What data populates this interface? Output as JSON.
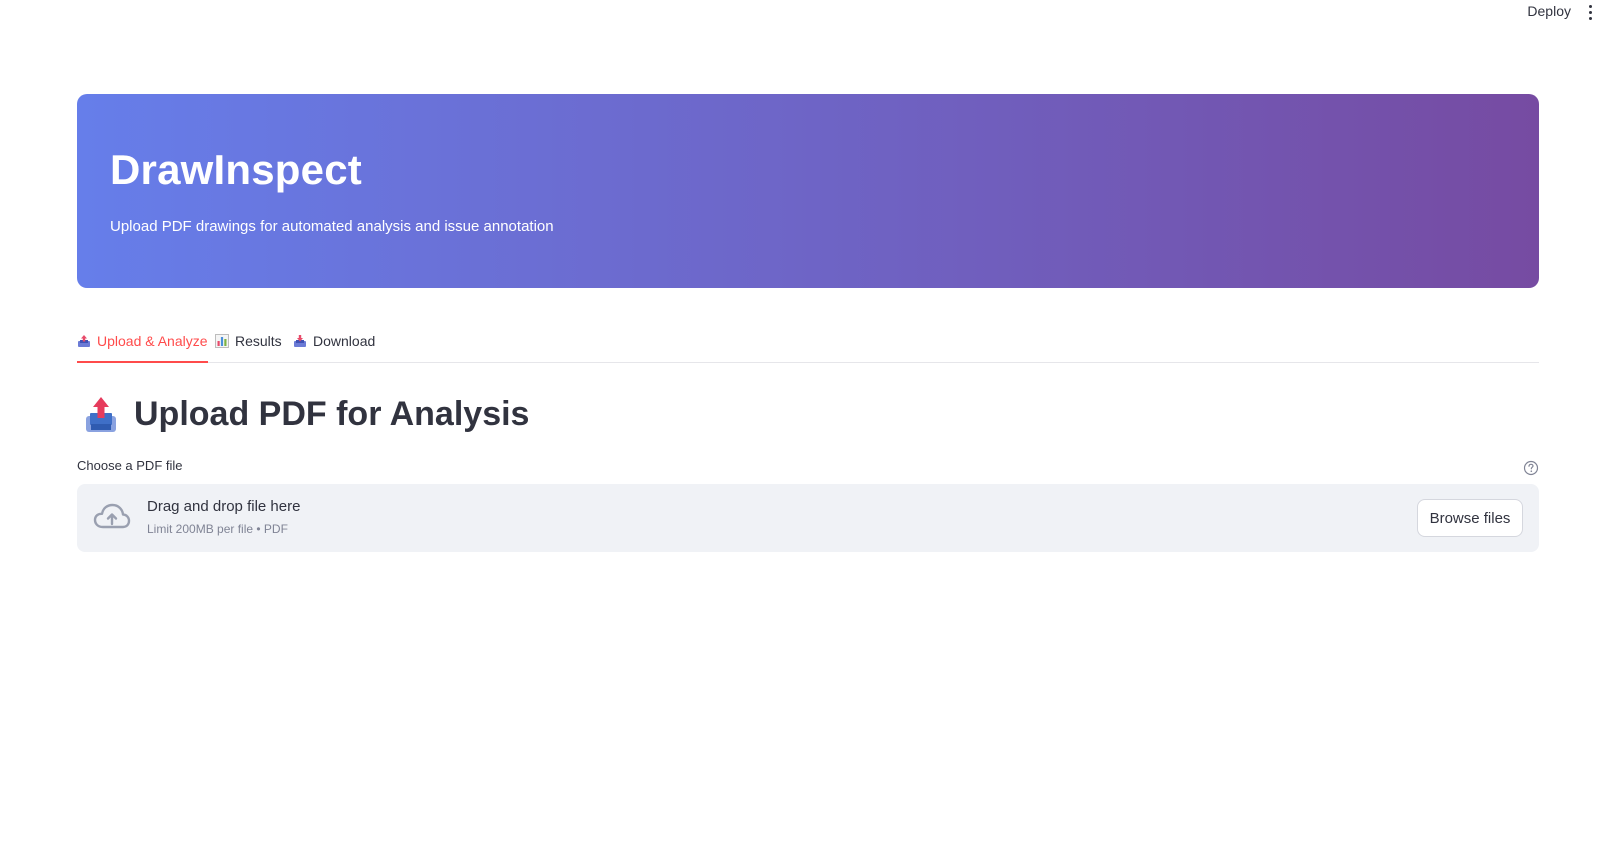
{
  "topbar": {
    "deploy_label": "Deploy",
    "menu_icon": "more-vertical-icon"
  },
  "hero": {
    "title": "DrawInspect",
    "subtitle": "Upload PDF drawings for automated analysis and issue annotation",
    "gradient_start": "#667eea",
    "gradient_end": "#764ba2"
  },
  "tabs": [
    {
      "label": "Upload & Analyze",
      "icon": "inbox-tray-icon",
      "active": true
    },
    {
      "label": "Results",
      "icon": "bar-chart-icon",
      "active": false
    },
    {
      "label": "Download",
      "icon": "inbox-tray-icon",
      "active": false
    }
  ],
  "section": {
    "title": "Upload PDF for Analysis",
    "icon": "outbox-tray-icon"
  },
  "uploader": {
    "label": "Choose a PDF file",
    "help_icon": "question-circle-icon",
    "drop_text": "Drag and drop file here",
    "limit_text": "Limit 200MB per file • PDF",
    "browse_label": "Browse files",
    "cloud_icon": "cloud-upload-icon"
  },
  "colors": {
    "accent": "#ff4b4b",
    "text": "#31333f",
    "muted": "#808495",
    "dropzone_bg": "#f0f2f6"
  }
}
